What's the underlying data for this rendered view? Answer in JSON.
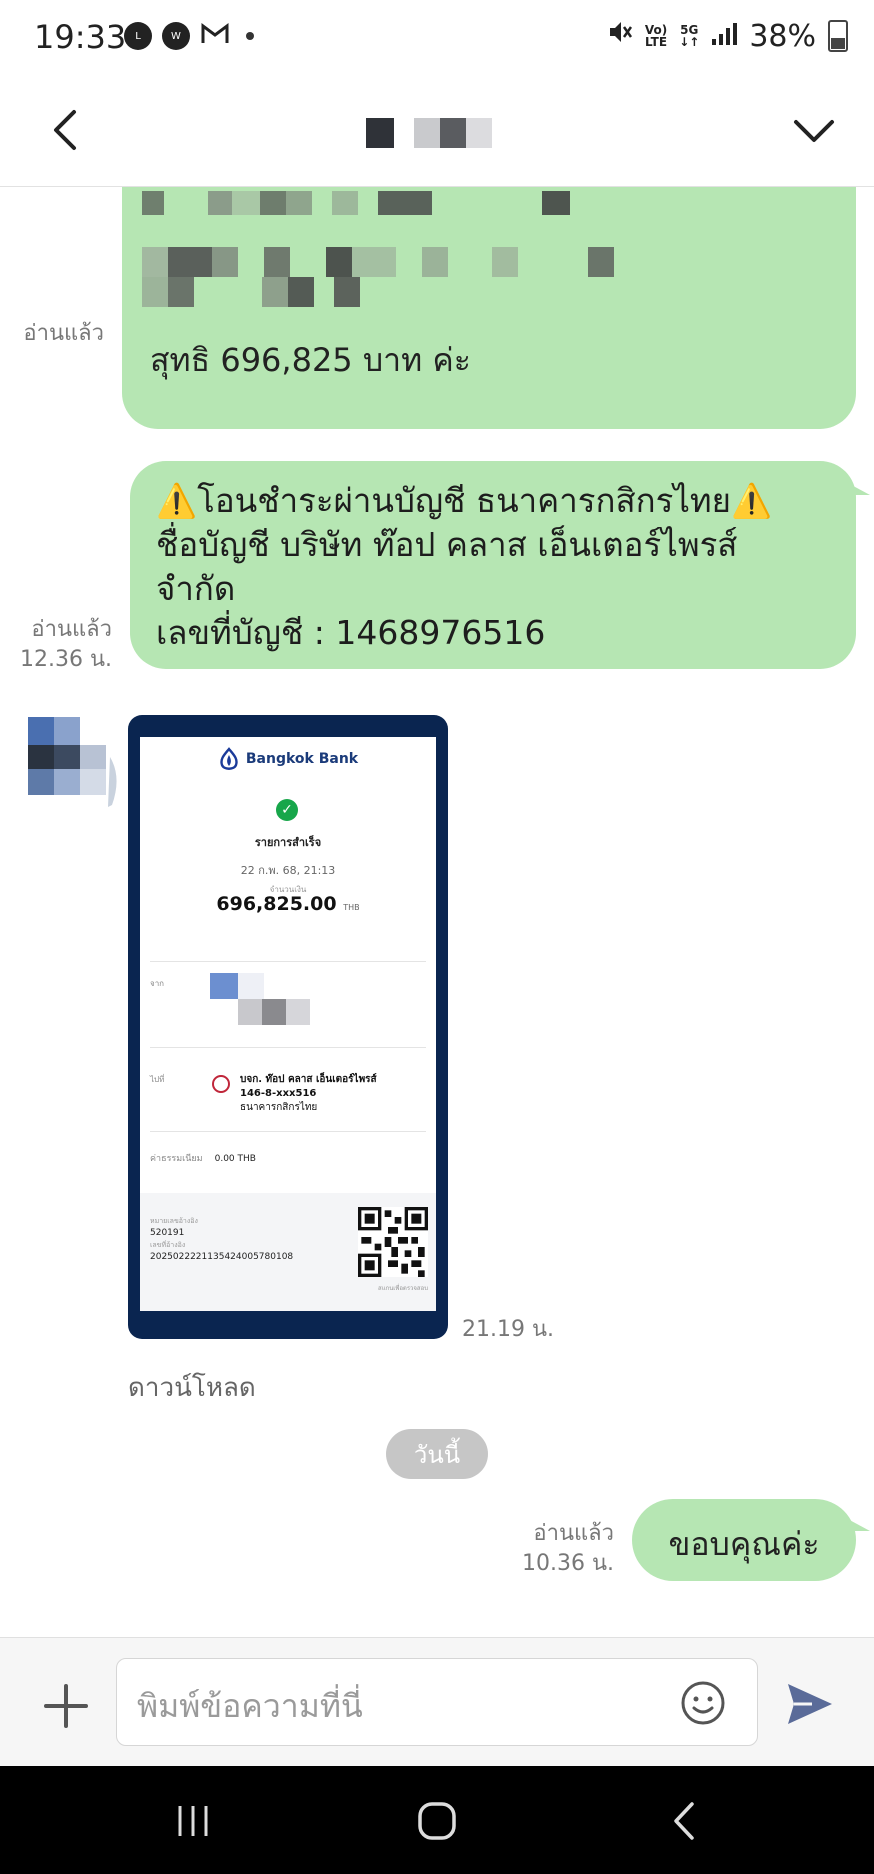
{
  "status_bar": {
    "time": "19:33",
    "volte": "Vo)\nLTE",
    "network": "5G",
    "battery": "38%",
    "icons": [
      "line-icon",
      "wechat-icon",
      "gmail-icon",
      "dot-icon",
      "mute-icon",
      "volte-icon",
      "5g-icon",
      "signal-icon",
      "battery-icon"
    ]
  },
  "header": {
    "icons": [
      "back-icon",
      "chevron-down-icon"
    ]
  },
  "messages": [
    {
      "id": "m1",
      "sender": "me",
      "text": "สุทธิ 696,825 บาท ค่ะ",
      "read": "อ่านแล้ว",
      "time": ""
    },
    {
      "id": "m2",
      "sender": "me",
      "line1": "⚠️โอนชำระผ่านบัญชี ธนาคารกสิกรไทย⚠️",
      "line2": "ชื่อบัญชี บริษัท ท๊อป คลาส เอ็นเตอร์ไพรส์",
      "line3": "จำกัด",
      "line4": "เลขที่บัญชี : 1468976516",
      "read": "อ่านแล้ว",
      "time": "12.36 น."
    },
    {
      "id": "m3",
      "sender": "other",
      "type": "image",
      "time": "21.19 น.",
      "download": "ดาวน์โหลด",
      "receipt": {
        "bank": "Bangkok Bank",
        "status": "รายการสำเร็จ",
        "date": "22 ก.พ. 68, 21:13",
        "amount_label": "จำนวนเงิน",
        "amount": "696,825.00",
        "currency": "THB",
        "from_label": "จาก",
        "to_label": "ไปที่",
        "to_name": "บจก. ท๊อป คลาส เอ็นเตอร์ไพรส์",
        "to_account": "146-8-xxx516",
        "to_bank": "ธนาคารกสิกรไทย",
        "fee_label": "ค่าธรรมเนียม",
        "fee": "0.00 THB",
        "ref1_label": "หมายเลขอ้างอิง",
        "ref1": "520191",
        "ref2_label": "เลขที่อ้างอิง",
        "ref2": "2025022221135424005780108",
        "qr_caption": "สแกนเพื่อตรวจสอบ"
      }
    },
    {
      "id": "divider",
      "label": "วันนี้"
    },
    {
      "id": "m4",
      "sender": "me",
      "text": "ขอบคุณค่ะ",
      "read": "อ่านแล้ว",
      "time": "10.36 น."
    }
  ],
  "composer": {
    "placeholder": "พิมพ์ข้อความที่นี่",
    "icons": [
      "plus-icon",
      "emoji-icon",
      "send-icon"
    ]
  },
  "nav_bar": {
    "icons": [
      "recent-apps-icon",
      "home-icon",
      "back-nav-icon"
    ]
  },
  "colors": {
    "bubble_me": "#b6e6b3",
    "receipt_frame": "#0a2550",
    "send_accent": "#5a6b99"
  }
}
